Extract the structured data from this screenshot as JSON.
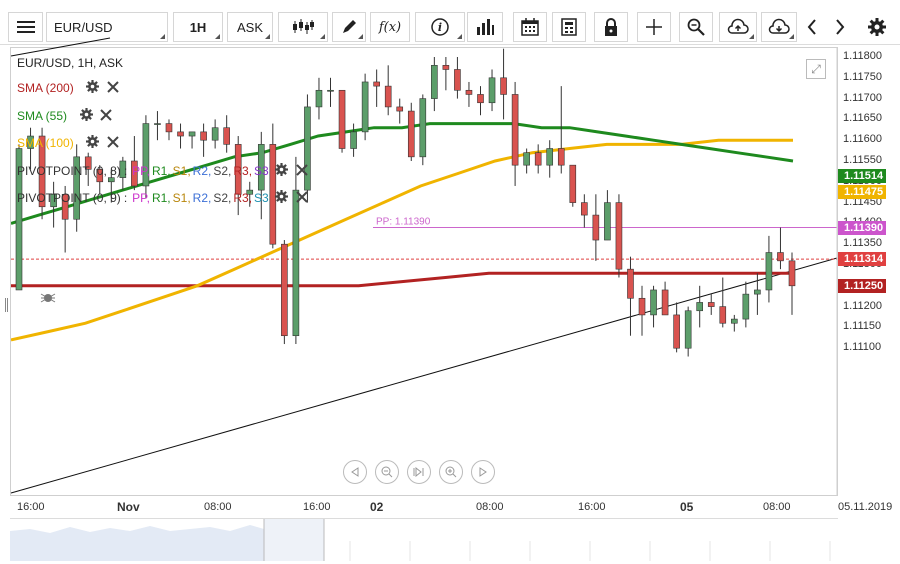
{
  "toolbar": {
    "menu_icon": "hamburger-menu-icon",
    "symbol": "EUR/USD",
    "timeframe": "1H",
    "price_type": "ASK",
    "icons": [
      "candlestick-icon",
      "pencil-icon",
      "function-icon",
      "info-icon",
      "bar-chart-icon",
      "calendar-icon",
      "calculator-icon",
      "lock-icon",
      "crosshair-icon",
      "zoom-icon",
      "cloud-upload-icon",
      "cloud-download-icon",
      "chevron-left-icon",
      "chevron-right-icon",
      "gear-icon"
    ],
    "function_label": "f(x)"
  },
  "chart_title": "EUR/USD, 1H, ASK",
  "indicators": [
    {
      "label": "SMA (200)",
      "color": "#b22222"
    },
    {
      "label": "SMA (55)",
      "color": "#1e8a1e"
    },
    {
      "label": "SMA (100)",
      "color": "#f0b400"
    }
  ],
  "pivots": [
    {
      "label": "PIVOTPOINT (0, 8)",
      "parts": [
        {
          "text": "PP,",
          "color": "#cc33cc"
        },
        {
          "text": "R1,",
          "color": "#1e8a1e"
        },
        {
          "text": "S1,",
          "color": "#b8860b"
        },
        {
          "text": "R2,",
          "color": "#3b6fd6"
        },
        {
          "text": "S2,",
          "color": "#444444"
        },
        {
          "text": "R3,",
          "color": "#b22222"
        },
        {
          "text": "S3",
          "color": "#8833cc"
        }
      ]
    },
    {
      "label": "PIVOTPOINT (0, 9)",
      "parts": [
        {
          "text": "PP,",
          "color": "#cc33cc"
        },
        {
          "text": "R1,",
          "color": "#1e8a1e"
        },
        {
          "text": "S1,",
          "color": "#b8860b"
        },
        {
          "text": "R2,",
          "color": "#3b6fd6"
        },
        {
          "text": "S2,",
          "color": "#444444"
        },
        {
          "text": "R3,",
          "color": "#b22222"
        },
        {
          "text": "S3",
          "color": "#1e90b0"
        }
      ]
    }
  ],
  "pp_line_label": "PP: 1.11390",
  "price_axis": [
    "1.11800",
    "1.11750",
    "1.11700",
    "1.11650",
    "1.11600",
    "1.11550",
    "1.11500",
    "1.11450",
    "1.11400",
    "1.11350",
    "1.11300",
    "1.11250",
    "1.11200",
    "1.11150",
    "1.11100"
  ],
  "price_tags": [
    {
      "value": "1.11514",
      "color": "#1e8a1e"
    },
    {
      "value": "1.11475",
      "color": "#f0b400"
    },
    {
      "value": "1.11390",
      "color": "#cc55cc"
    },
    {
      "value": "1.11314",
      "color": "#e04040"
    },
    {
      "value": "1.11250",
      "color": "#b22222"
    }
  ],
  "time_axis": [
    {
      "text": "16:00",
      "bold": false
    },
    {
      "text": "Nov",
      "bold": true
    },
    {
      "text": "08:00",
      "bold": false
    },
    {
      "text": "16:00",
      "bold": false
    },
    {
      "text": "16:00",
      "bold": false
    },
    {
      "text": "02",
      "bold": true
    },
    {
      "text": "08:00",
      "bold": false
    },
    {
      "text": "16:00",
      "bold": false
    },
    {
      "text": "05",
      "bold": true
    },
    {
      "text": "08:00",
      "bold": false
    },
    {
      "text": "05.11.2019",
      "bold": false
    }
  ],
  "colors": {
    "bull": "#5c9e6a",
    "bear": "#d9534f",
    "pp": "#cc66cc",
    "last": "#e04040"
  },
  "chart_data": {
    "type": "candlestick",
    "ylim": [
      1.1108,
      1.1182
    ],
    "candles": [
      [
        1.1124,
        1.1159,
        1.1134,
        1.1158
      ],
      [
        1.1158,
        1.1163,
        1.1153,
        1.1161
      ],
      [
        1.1161,
        1.1163,
        1.1141,
        1.1144
      ],
      [
        1.1144,
        1.115,
        1.1139,
        1.1147
      ],
      [
        1.1147,
        1.1149,
        1.1133,
        1.1141
      ],
      [
        1.1141,
        1.1159,
        1.1138,
        1.1156
      ],
      [
        1.1156,
        1.1157,
        1.1149,
        1.1153
      ],
      [
        1.1153,
        1.1154,
        1.1147,
        1.115
      ],
      [
        1.115,
        1.1153,
        1.1145,
        1.1151
      ],
      [
        1.1151,
        1.1156,
        1.1148,
        1.1155
      ],
      [
        1.1155,
        1.1161,
        1.1148,
        1.1149
      ],
      [
        1.1149,
        1.1166,
        1.1146,
        1.1164
      ],
      [
        1.1164,
        1.1167,
        1.116,
        1.1164
      ],
      [
        1.1164,
        1.1165,
        1.116,
        1.1162
      ],
      [
        1.1162,
        1.1164,
        1.1158,
        1.1161
      ],
      [
        1.1161,
        1.1162,
        1.1158,
        1.1162
      ],
      [
        1.1162,
        1.1164,
        1.1156,
        1.116
      ],
      [
        1.116,
        1.1165,
        1.1158,
        1.1163
      ],
      [
        1.1163,
        1.1166,
        1.1157,
        1.1159
      ],
      [
        1.1159,
        1.1161,
        1.1142,
        1.1147
      ],
      [
        1.1147,
        1.115,
        1.1144,
        1.1148
      ],
      [
        1.1148,
        1.1162,
        1.1141,
        1.1159
      ],
      [
        1.1159,
        1.1164,
        1.1134,
        1.1135
      ],
      [
        1.1135,
        1.1136,
        1.1111,
        1.1113
      ],
      [
        1.1113,
        1.1156,
        1.1111,
        1.1148
      ],
      [
        1.1148,
        1.1171,
        1.1145,
        1.1168
      ],
      [
        1.1168,
        1.1175,
        1.1165,
        1.1172
      ],
      [
        1.1172,
        1.1175,
        1.1168,
        1.1172
      ],
      [
        1.1172,
        1.1172,
        1.1157,
        1.1158
      ],
      [
        1.1158,
        1.1164,
        1.1156,
        1.1162
      ],
      [
        1.1162,
        1.1176,
        1.116,
        1.1174
      ],
      [
        1.1174,
        1.1177,
        1.1168,
        1.1173
      ],
      [
        1.1173,
        1.1178,
        1.1166,
        1.1168
      ],
      [
        1.1168,
        1.117,
        1.1164,
        1.1167
      ],
      [
        1.1167,
        1.1169,
        1.1155,
        1.1156
      ],
      [
        1.1156,
        1.1171,
        1.1154,
        1.117
      ],
      [
        1.117,
        1.118,
        1.1167,
        1.1178
      ],
      [
        1.1178,
        1.118,
        1.1172,
        1.1177
      ],
      [
        1.1177,
        1.118,
        1.117,
        1.1172
      ],
      [
        1.1172,
        1.1174,
        1.1168,
        1.1171
      ],
      [
        1.1171,
        1.1173,
        1.1166,
        1.1169
      ],
      [
        1.1169,
        1.1177,
        1.1167,
        1.1175
      ],
      [
        1.1175,
        1.1182,
        1.1165,
        1.1171
      ],
      [
        1.1171,
        1.1174,
        1.1149,
        1.1154
      ],
      [
        1.1154,
        1.1158,
        1.1152,
        1.1157
      ],
      [
        1.1157,
        1.1159,
        1.1152,
        1.1154
      ],
      [
        1.1154,
        1.116,
        1.1151,
        1.1158
      ],
      [
        1.1158,
        1.1173,
        1.1152,
        1.1154
      ],
      [
        1.1154,
        1.1154,
        1.1144,
        1.1145
      ],
      [
        1.1145,
        1.1147,
        1.1139,
        1.1142
      ],
      [
        1.1142,
        1.1147,
        1.1131,
        1.1136
      ],
      [
        1.1136,
        1.1148,
        1.1136,
        1.1145
      ],
      [
        1.1145,
        1.1147,
        1.1127,
        1.1129
      ],
      [
        1.1129,
        1.1132,
        1.1113,
        1.1122
      ],
      [
        1.1122,
        1.1125,
        1.1113,
        1.1118
      ],
      [
        1.1118,
        1.1125,
        1.1115,
        1.1124
      ],
      [
        1.1124,
        1.1126,
        1.1118,
        1.1118
      ],
      [
        1.1118,
        1.1121,
        1.1109,
        1.111
      ],
      [
        1.111,
        1.112,
        1.1108,
        1.1119
      ],
      [
        1.1119,
        1.1125,
        1.1115,
        1.1121
      ],
      [
        1.1121,
        1.1123,
        1.1118,
        1.112
      ],
      [
        1.112,
        1.1127,
        1.1115,
        1.1116
      ],
      [
        1.1116,
        1.1118,
        1.1114,
        1.1117
      ],
      [
        1.1117,
        1.1126,
        1.1115,
        1.1123
      ],
      [
        1.1123,
        1.1128,
        1.1118,
        1.1124
      ],
      [
        1.1124,
        1.1137,
        1.1121,
        1.1133
      ],
      [
        1.1133,
        1.1139,
        1.1129,
        1.1131
      ],
      [
        1.1131,
        1.1133,
        1.1118,
        1.1125
      ]
    ],
    "sma55": [
      1.114,
      1.1142,
      1.1144,
      1.1146,
      1.1148,
      1.115,
      1.1152,
      1.1154,
      1.1156,
      1.1157,
      1.1159,
      1.1161,
      1.1162,
      1.1163,
      1.1163,
      1.1164,
      1.1164,
      1.1164,
      1.1164,
      1.1163,
      1.1163,
      1.1162,
      1.1161,
      1.116,
      1.1159,
      1.1158,
      1.1157,
      1.1156,
      1.1155
    ],
    "sma100": [
      1.1112,
      1.1114,
      1.1116,
      1.1119,
      1.1122,
      1.1125,
      1.1129,
      1.1133,
      1.1137,
      1.1141,
      1.1145,
      1.1149,
      1.1152,
      1.1155,
      1.1157,
      1.1158,
      1.1159,
      1.1159,
      1.1159,
      1.116,
      1.116,
      1.116
    ],
    "sma200": [
      1.1125,
      1.1125,
      1.1125,
      1.1125,
      1.1125,
      1.1125,
      1.1125,
      1.1125,
      1.1125,
      1.1126,
      1.1127,
      1.1128,
      1.1128,
      1.1128,
      1.1128,
      1.1128,
      1.1128,
      1.1128,
      1.1128
    ],
    "pivot_pp": 1.1139,
    "last": 1.11314
  }
}
